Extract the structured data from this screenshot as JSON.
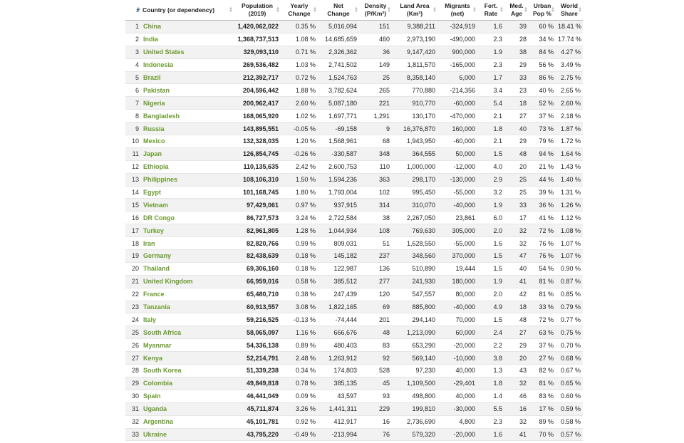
{
  "headers": [
    {
      "label": "#",
      "sub": "",
      "align": "right",
      "sort_active": true
    },
    {
      "label": "Country (or dependency)",
      "sub": "",
      "align": "left",
      "sort_active": false
    },
    {
      "label": "Population",
      "sub": "(2019)",
      "align": "center",
      "sort_active": false
    },
    {
      "label": "Yearly",
      "sub": "Change",
      "align": "center",
      "sort_active": false
    },
    {
      "label": "Net",
      "sub": "Change",
      "align": "center",
      "sort_active": false
    },
    {
      "label": "Density",
      "sub": "(P/Km²)",
      "align": "center",
      "sort_active": false
    },
    {
      "label": "Land Area",
      "sub": "(Km²)",
      "align": "center",
      "sort_active": false
    },
    {
      "label": "Migrants",
      "sub": "(net)",
      "align": "center",
      "sort_active": false
    },
    {
      "label": "Fert.",
      "sub": "Rate",
      "align": "center",
      "sort_active": false
    },
    {
      "label": "Med.",
      "sub": "Age",
      "align": "center",
      "sort_active": false
    },
    {
      "label": "Urban",
      "sub": "Pop %",
      "align": "center",
      "sort_active": false
    },
    {
      "label": "World",
      "sub": "Share",
      "align": "center",
      "sort_active": false
    }
  ],
  "rows": [
    [
      "1",
      "China",
      "1,420,062,022",
      "0.35 %",
      "5,016,094",
      "151",
      "9,388,211",
      "-324,919",
      "1.6",
      "39",
      "60 %",
      "18.41 %"
    ],
    [
      "2",
      "India",
      "1,368,737,513",
      "1.08 %",
      "14,685,659",
      "460",
      "2,973,190",
      "-490,000",
      "2.3",
      "28",
      "34 %",
      "17.74 %"
    ],
    [
      "3",
      "United States",
      "329,093,110",
      "0.71 %",
      "2,326,362",
      "36",
      "9,147,420",
      "900,000",
      "1.9",
      "38",
      "84 %",
      "4.27 %"
    ],
    [
      "4",
      "Indonesia",
      "269,536,482",
      "1.03 %",
      "2,741,502",
      "149",
      "1,811,570",
      "-165,000",
      "2.3",
      "29",
      "56 %",
      "3.49 %"
    ],
    [
      "5",
      "Brazil",
      "212,392,717",
      "0.72 %",
      "1,524,763",
      "25",
      "8,358,140",
      "6,000",
      "1.7",
      "33",
      "86 %",
      "2.75 %"
    ],
    [
      "6",
      "Pakistan",
      "204,596,442",
      "1.88 %",
      "3,782,624",
      "265",
      "770,880",
      "-214,356",
      "3.4",
      "23",
      "40 %",
      "2.65 %"
    ],
    [
      "7",
      "Nigeria",
      "200,962,417",
      "2.60 %",
      "5,087,180",
      "221",
      "910,770",
      "-60,000",
      "5.4",
      "18",
      "52 %",
      "2.60 %"
    ],
    [
      "8",
      "Bangladesh",
      "168,065,920",
      "1.02 %",
      "1,697,771",
      "1,291",
      "130,170",
      "-470,000",
      "2.1",
      "27",
      "37 %",
      "2.18 %"
    ],
    [
      "9",
      "Russia",
      "143,895,551",
      "-0.05 %",
      "-69,158",
      "9",
      "16,376,870",
      "160,000",
      "1.8",
      "40",
      "73 %",
      "1.87 %"
    ],
    [
      "10",
      "Mexico",
      "132,328,035",
      "1.20 %",
      "1,568,961",
      "68",
      "1,943,950",
      "-60,000",
      "2.1",
      "29",
      "79 %",
      "1.72 %"
    ],
    [
      "11",
      "Japan",
      "126,854,745",
      "-0.26 %",
      "-330,587",
      "348",
      "364,555",
      "50,000",
      "1.5",
      "48",
      "94 %",
      "1.64 %"
    ],
    [
      "12",
      "Ethiopia",
      "110,135,635",
      "2.42 %",
      "2,600,753",
      "110",
      "1,000,000",
      "-12,000",
      "4.0",
      "20",
      "21 %",
      "1.43 %"
    ],
    [
      "13",
      "Philippines",
      "108,106,310",
      "1.50 %",
      "1,594,236",
      "363",
      "298,170",
      "-130,000",
      "2.9",
      "25",
      "44 %",
      "1.40 %"
    ],
    [
      "14",
      "Egypt",
      "101,168,745",
      "1.80 %",
      "1,793,004",
      "102",
      "995,450",
      "-55,000",
      "3.2",
      "25",
      "39 %",
      "1.31 %"
    ],
    [
      "15",
      "Vietnam",
      "97,429,061",
      "0.97 %",
      "937,915",
      "314",
      "310,070",
      "-40,000",
      "1.9",
      "33",
      "36 %",
      "1.26 %"
    ],
    [
      "16",
      "DR Congo",
      "86,727,573",
      "3.24 %",
      "2,722,584",
      "38",
      "2,267,050",
      "23,861",
      "6.0",
      "17",
      "41 %",
      "1.12 %"
    ],
    [
      "17",
      "Turkey",
      "82,961,805",
      "1.28 %",
      "1,044,934",
      "108",
      "769,630",
      "305,000",
      "2.0",
      "32",
      "72 %",
      "1.08 %"
    ],
    [
      "18",
      "Iran",
      "82,820,766",
      "0.99 %",
      "809,031",
      "51",
      "1,628,550",
      "-55,000",
      "1.6",
      "32",
      "76 %",
      "1.07 %"
    ],
    [
      "19",
      "Germany",
      "82,438,639",
      "0.18 %",
      "145,182",
      "237",
      "348,560",
      "370,000",
      "1.5",
      "47",
      "76 %",
      "1.07 %"
    ],
    [
      "20",
      "Thailand",
      "69,306,160",
      "0.18 %",
      "122,987",
      "136",
      "510,890",
      "19,444",
      "1.5",
      "40",
      "54 %",
      "0.90 %"
    ],
    [
      "21",
      "United Kingdom",
      "66,959,016",
      "0.58 %",
      "385,512",
      "277",
      "241,930",
      "180,000",
      "1.9",
      "41",
      "81 %",
      "0.87 %"
    ],
    [
      "22",
      "France",
      "65,480,710",
      "0.38 %",
      "247,439",
      "120",
      "547,557",
      "80,000",
      "2.0",
      "42",
      "81 %",
      "0.85 %"
    ],
    [
      "23",
      "Tanzania",
      "60,913,557",
      "3.08 %",
      "1,822,165",
      "69",
      "885,800",
      "-40,000",
      "4.9",
      "18",
      "33 %",
      "0.79 %"
    ],
    [
      "24",
      "Italy",
      "59,216,525",
      "-0.13 %",
      "-74,444",
      "201",
      "294,140",
      "70,000",
      "1.5",
      "48",
      "72 %",
      "0.77 %"
    ],
    [
      "25",
      "South Africa",
      "58,065,097",
      "1.16 %",
      "666,676",
      "48",
      "1,213,090",
      "60,000",
      "2.4",
      "27",
      "63 %",
      "0.75 %"
    ],
    [
      "26",
      "Myanmar",
      "54,336,138",
      "0.89 %",
      "480,403",
      "83",
      "653,290",
      "-20,000",
      "2.2",
      "29",
      "37 %",
      "0.70 %"
    ],
    [
      "27",
      "Kenya",
      "52,214,791",
      "2.48 %",
      "1,263,912",
      "92",
      "569,140",
      "-10,000",
      "3.8",
      "20",
      "27 %",
      "0.68 %"
    ],
    [
      "28",
      "South Korea",
      "51,339,238",
      "0.34 %",
      "174,803",
      "528",
      "97,230",
      "40,000",
      "1.3",
      "43",
      "82 %",
      "0.67 %"
    ],
    [
      "29",
      "Colombia",
      "49,849,818",
      "0.78 %",
      "385,135",
      "45",
      "1,109,500",
      "-29,401",
      "1.8",
      "32",
      "81 %",
      "0.65 %"
    ],
    [
      "30",
      "Spain",
      "46,441,049",
      "0.09 %",
      "43,597",
      "93",
      "498,800",
      "40,000",
      "1.4",
      "46",
      "83 %",
      "0.60 %"
    ],
    [
      "31",
      "Uganda",
      "45,711,874",
      "3.26 %",
      "1,441,311",
      "229",
      "199,810",
      "-30,000",
      "5.5",
      "16",
      "17 %",
      "0.59 %"
    ],
    [
      "32",
      "Argentina",
      "45,101,781",
      "0.92 %",
      "412,917",
      "16",
      "2,736,690",
      "4,800",
      "2.3",
      "32",
      "89 %",
      "0.58 %"
    ],
    [
      "33",
      "Ukraine",
      "43,795,220",
      "-0.49 %",
      "-213,994",
      "76",
      "579,320",
      "-20,000",
      "1.6",
      "41",
      "70 %",
      "0.57 %"
    ]
  ]
}
